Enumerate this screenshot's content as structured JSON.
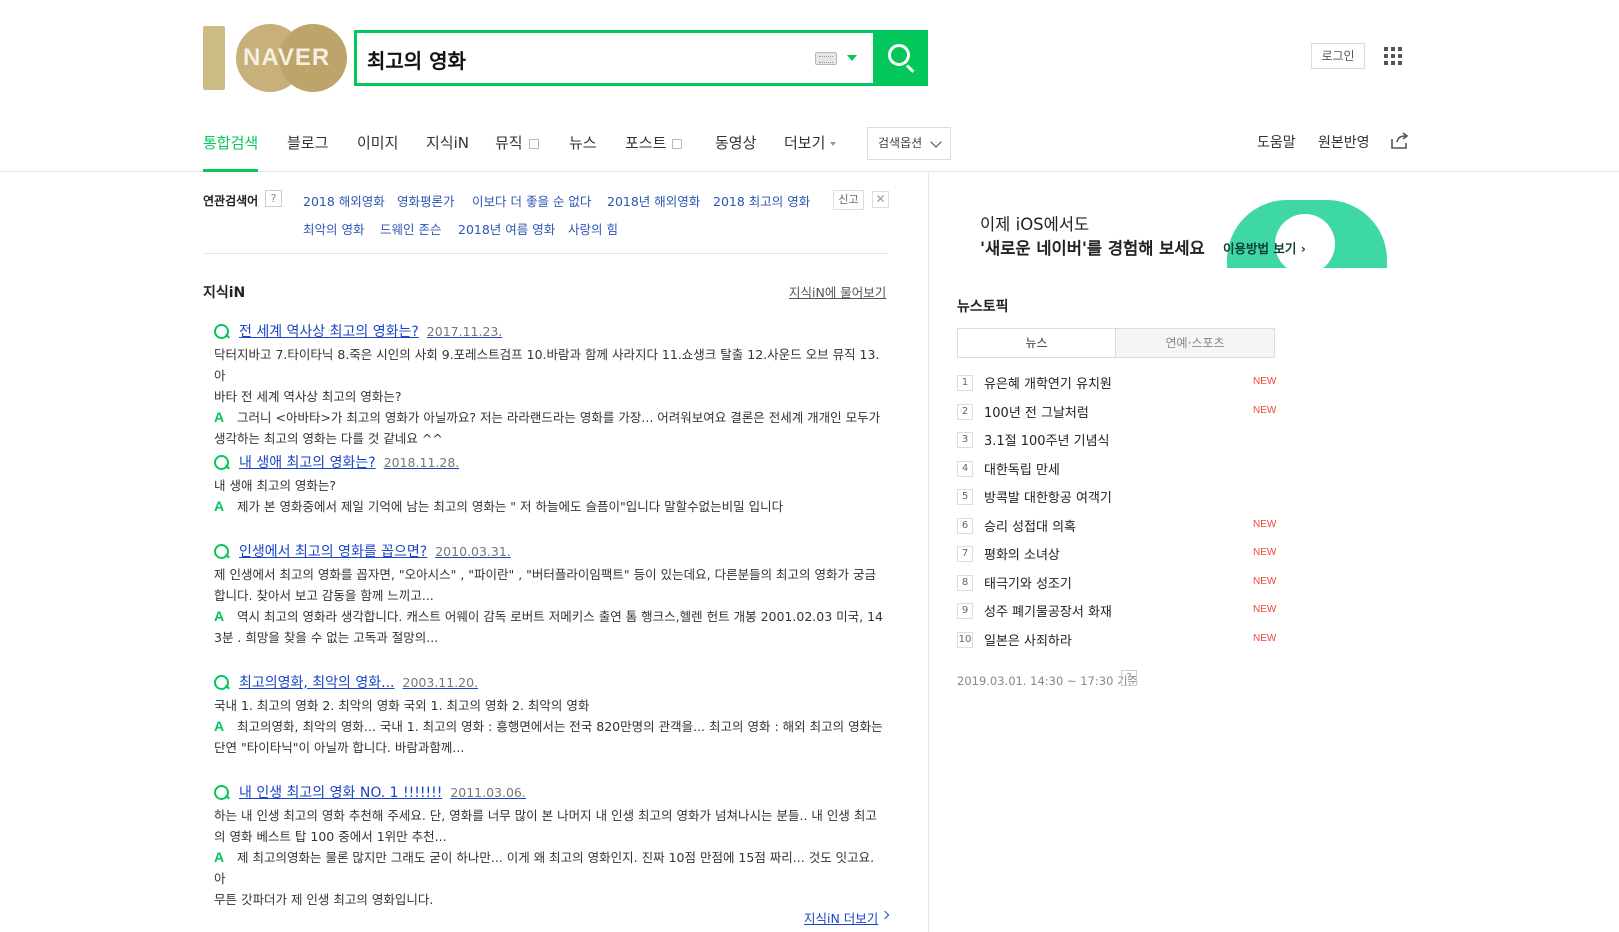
{
  "header": {
    "logo_text": "NAVER",
    "search_value": "최고의 영화",
    "login_label": "로그인"
  },
  "tabs": {
    "items": [
      {
        "label": "통합검색",
        "active": true
      },
      {
        "label": "블로그"
      },
      {
        "label": "이미지"
      },
      {
        "label": "지식iN"
      },
      {
        "label": "뮤직"
      },
      {
        "label": "뉴스"
      },
      {
        "label": "포스트"
      },
      {
        "label": "동영상"
      },
      {
        "label": "더보기"
      }
    ],
    "options_label": "검색옵션",
    "help_label": "도움말",
    "feedback_label": "원본반영"
  },
  "related": {
    "title": "연관검색어",
    "help": "?",
    "keywords": [
      "2018 해외영화",
      "영화평론가",
      "이보다 더 좋을 순 없다",
      "2018년 해외영화",
      "2018 최고의 영화",
      "최악의 영화",
      "드웨인 존슨",
      "2018년 여름 영화",
      "사랑의 힘"
    ],
    "report_label": "신고",
    "close_label": "✕"
  },
  "kin": {
    "title": "지식iN",
    "ask_label": "지식iN에 물어보기",
    "more_label": "지식iN 더보기",
    "items": [
      {
        "question": "전 세계 역사상 최고의 영화는?",
        "date": "2017.11.23.",
        "q_text_1": "닥터지바고 7.타이타닉 8.죽은 시인의 사회 9.포레스트검프 10.바람과 함께 사라지다 11.쇼생크 탈출 12.사운드 오브 뮤직 13.아",
        "q_text_2": "바타 전 세계 역사상 최고의 영화는?",
        "a_text_1": "그러니 <아바타>가 최고의 영화가 아닐까요? 저는 라라랜드라는 영화를 가장... 어려워보여요 결론은 전세계 개개인 모두가",
        "a_text_2": "생각하는 최고의 영화는 다를 것 같네요 ^^"
      },
      {
        "question": "내 생애 최고의 영화는?",
        "date": "2018.11.28.",
        "q_text_1": "내 생애 최고의 영화는?",
        "a_text_1": "제가 본 영화중에서 제일 기억에 남는 최고의 영화는 \" 저 하늘에도 슬픔이\"입니다 말할수없는비밀 입니다"
      },
      {
        "question": "인생에서 최고의 영화를 꼽으면?",
        "date": "2010.03.31.",
        "q_text_1": "제 인생에서 최고의 영화를 꼽자면, \"오아시스\" , \"파이란\" , \"버터플라이임팩트\" 등이 있는데요, 다른분들의 최고의 영화가 궁금",
        "q_text_2": "합니다. 찾아서 보고 감동을 함께 느끼고...",
        "a_text_1": "역시 최고의 영화라 생각합니다. 캐스트 어웨이 감독 로버트 저메키스 출연 톰 행크스,헬렌 헌트 개봉 2001.02.03 미국, 14",
        "a_text_2": "3분 . 희망을 찾을 수 없는 고독과 절망의..."
      },
      {
        "question": "최고의영화, 최악의 영화...",
        "date": "2003.11.20.",
        "q_text_1": "국내 1. 최고의 영화 2. 최악의 영화 국외 1. 최고의 영화 2. 최악의 영화",
        "a_text_1": "최고의영화, 최악의 영화... 국내 1. 최고의 영화 : 흥행면에서는 전국 820만명의 관객을... 최고의 영화 : 해외 최고의 영화는",
        "a_text_2": "단연 \"타이타닉\"이 아닐까 합니다. 바람과함께..."
      },
      {
        "question": "내 인생 최고의 영화 NO. 1 !!!!!!!",
        "date": "2011.03.06.",
        "q_text_1": "하는 내 인생 최고의 영화 추천해 주세요. 단, 영화를 너무 많이 본 나머지 내 인생 최고의 영화가 넘쳐나시는 분들.. 내 인생 최고",
        "q_text_2": "의 영화 베스트 탑 100 중에서 1위만 추천...",
        "a_text_1": "제 최고의영화는 물론 많지만 그래도 굳이 하나만... 이게 왜 최고의 영화인지. 진짜 10점 만점에 15점 짜리... 것도 잇고요. 아",
        "a_text_2": "무튼 갓파더가 제 인생 최고의 영화입니다."
      }
    ]
  },
  "banner": {
    "line1": "이제 iOS에서도",
    "line2": "'새로운 네이버'를 경험해 보세요",
    "cta": "이용방법 보기 ›"
  },
  "news": {
    "title": "뉴스토픽",
    "tab_news": "뉴스",
    "tab_ent": "연예·스포츠",
    "items": [
      {
        "rank": "1",
        "topic": "유은혜 개학연기 유치원",
        "new": "NEW"
      },
      {
        "rank": "2",
        "topic": "100년 전 그날처럼",
        "new": "NEW"
      },
      {
        "rank": "3",
        "topic": "3.1절 100주년 기념식",
        "new": ""
      },
      {
        "rank": "4",
        "topic": "대한독립 만세",
        "new": ""
      },
      {
        "rank": "5",
        "topic": "방콕발 대한항공 여객기",
        "new": ""
      },
      {
        "rank": "6",
        "topic": "승리 성접대 의혹",
        "new": "NEW"
      },
      {
        "rank": "7",
        "topic": "평화의 소녀상",
        "new": "NEW"
      },
      {
        "rank": "8",
        "topic": "태극기와 성조기",
        "new": "NEW"
      },
      {
        "rank": "9",
        "topic": "성주 폐기물공장서 화재",
        "new": "NEW"
      },
      {
        "rank": "10",
        "topic": "일본은 사죄하라",
        "new": "NEW"
      }
    ],
    "timestamp": "2019.03.01. 14:30 ~ 17:30 기준",
    "help": "?"
  },
  "colors": {
    "brand": "#03c75a",
    "link": "#1a44c9",
    "new": "#e94a3c"
  }
}
